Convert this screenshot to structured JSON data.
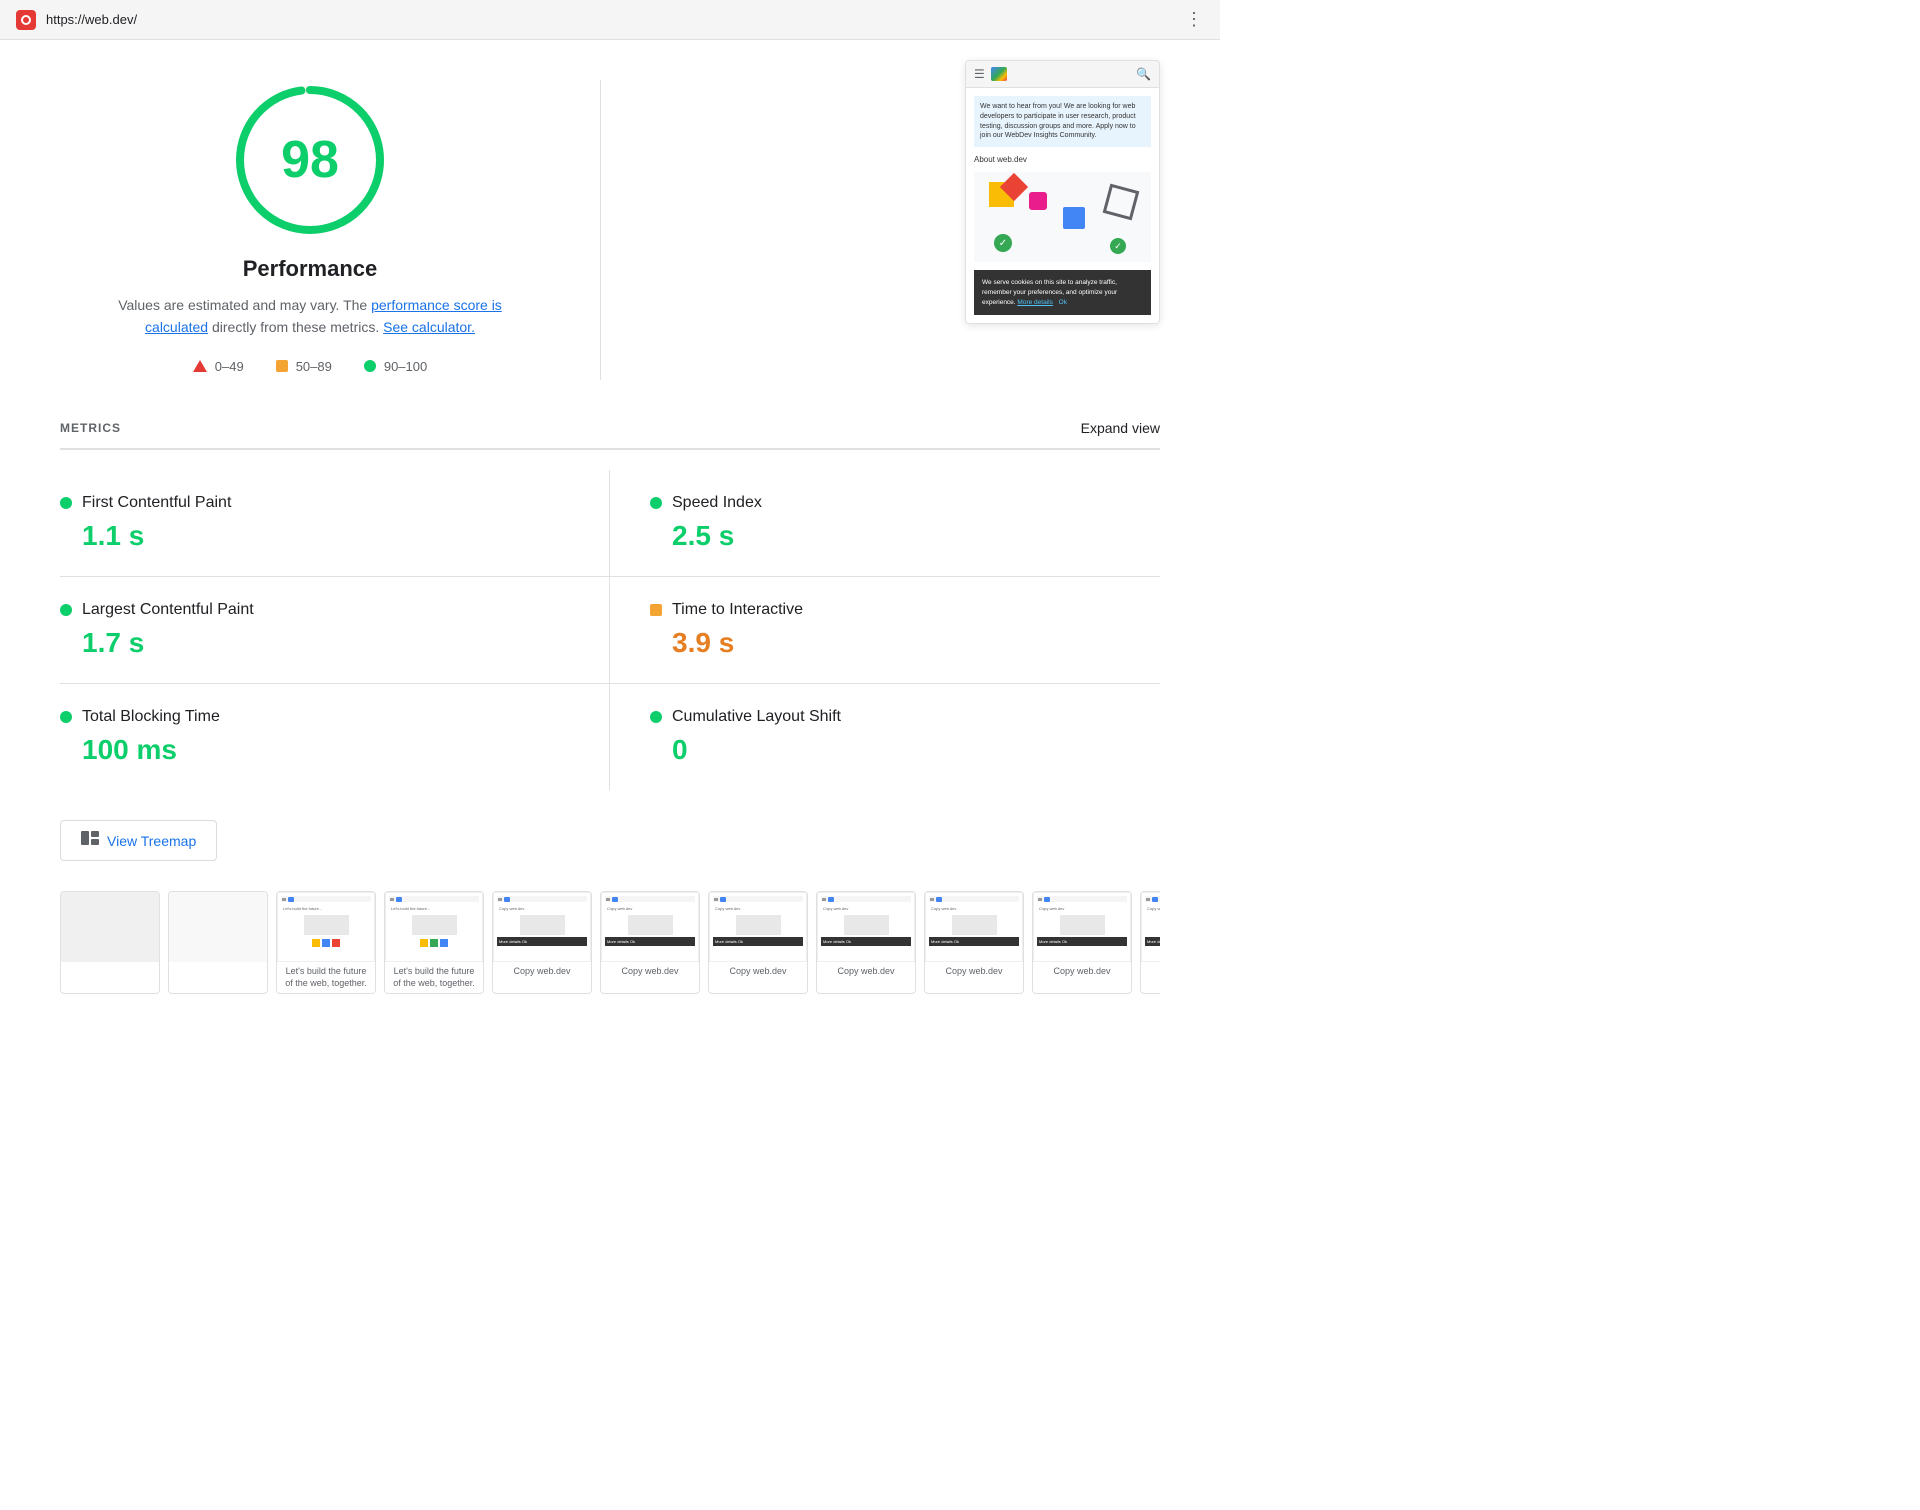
{
  "browser": {
    "url": "https://web.dev/",
    "menu_icon": "⋮"
  },
  "score_section": {
    "score": "98",
    "title": "Performance",
    "description_prefix": "Values are estimated and may vary. The ",
    "link1_text": "performance score is calculated",
    "description_middle": " directly from these metrics. ",
    "link2_text": "See calculator.",
    "legend": [
      {
        "range": "0–49",
        "type": "red"
      },
      {
        "range": "50–89",
        "type": "orange"
      },
      {
        "range": "90–100",
        "type": "green"
      }
    ]
  },
  "screenshot_preview": {
    "banner_text": "We want to hear from you! We are looking for web developers to participate in user research, product testing, discussion groups and more. Apply now to join our WebDev Insights Community.",
    "about_text": "About web.dev",
    "cookie_text": "We serve cookies on this site to analyze traffic, remember your preferences, and optimize your experience.",
    "cookie_link": "More details",
    "cookie_ok": "Ok"
  },
  "metrics_section": {
    "label": "METRICS",
    "expand_label": "Expand view",
    "items": [
      {
        "name": "First Contentful Paint",
        "value": "1.1 s",
        "status": "green",
        "position": "left"
      },
      {
        "name": "Speed Index",
        "value": "2.5 s",
        "status": "green",
        "position": "right"
      },
      {
        "name": "Largest Contentful Paint",
        "value": "1.7 s",
        "status": "green",
        "position": "left"
      },
      {
        "name": "Time to Interactive",
        "value": "3.9 s",
        "status": "orange",
        "position": "right"
      },
      {
        "name": "Total Blocking Time",
        "value": "100 ms",
        "status": "green",
        "position": "left"
      },
      {
        "name": "Cumulative Layout Shift",
        "value": "0",
        "status": "green",
        "position": "right"
      }
    ]
  },
  "treemap": {
    "button_label": "View Treemap"
  },
  "filmstrip": {
    "items": [
      {
        "caption": ""
      },
      {
        "caption": ""
      },
      {
        "caption": "Let's build the future of the web, together."
      },
      {
        "caption": "Let's build the future of the web, together."
      },
      {
        "caption": "Copy web.dev"
      },
      {
        "caption": "Copy web.dev"
      },
      {
        "caption": "Copy web.dev"
      },
      {
        "caption": "Copy web.dev"
      },
      {
        "caption": "Copy web.dev"
      },
      {
        "caption": "Copy web.dev"
      },
      {
        "caption": "Copy web.dev"
      }
    ]
  }
}
